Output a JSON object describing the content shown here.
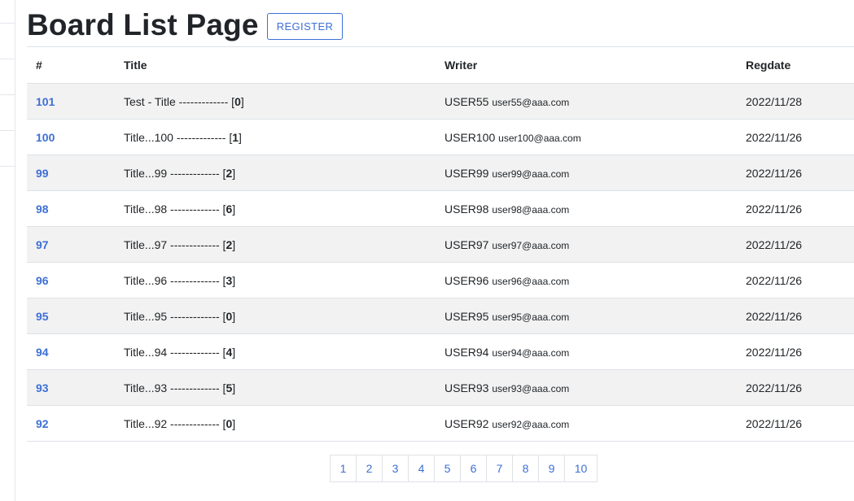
{
  "header": {
    "title": "Board List Page",
    "register_label": "REGISTER"
  },
  "table": {
    "columns": [
      "#",
      "Title",
      "Writer",
      "Regdate"
    ],
    "rows": [
      {
        "bno": "101",
        "title": "Test - Title ------------- [",
        "replies": "0",
        "writer": "USER55",
        "email": "user55@aaa.com",
        "regdate": "2022/11/28"
      },
      {
        "bno": "100",
        "title": "Title...100 ------------- [",
        "replies": "1",
        "writer": "USER100",
        "email": "user100@aaa.com",
        "regdate": "2022/11/26"
      },
      {
        "bno": "99",
        "title": "Title...99 ------------- [",
        "replies": "2",
        "writer": "USER99",
        "email": "user99@aaa.com",
        "regdate": "2022/11/26"
      },
      {
        "bno": "98",
        "title": "Title...98 ------------- [",
        "replies": "6",
        "writer": "USER98",
        "email": "user98@aaa.com",
        "regdate": "2022/11/26"
      },
      {
        "bno": "97",
        "title": "Title...97 ------------- [",
        "replies": "2",
        "writer": "USER97",
        "email": "user97@aaa.com",
        "regdate": "2022/11/26"
      },
      {
        "bno": "96",
        "title": "Title...96 ------------- [",
        "replies": "3",
        "writer": "USER96",
        "email": "user96@aaa.com",
        "regdate": "2022/11/26"
      },
      {
        "bno": "95",
        "title": "Title...95 ------------- [",
        "replies": "0",
        "writer": "USER95",
        "email": "user95@aaa.com",
        "regdate": "2022/11/26"
      },
      {
        "bno": "94",
        "title": "Title...94 ------------- [",
        "replies": "4",
        "writer": "USER94",
        "email": "user94@aaa.com",
        "regdate": "2022/11/26"
      },
      {
        "bno": "93",
        "title": "Title...93 ------------- [",
        "replies": "5",
        "writer": "USER93",
        "email": "user93@aaa.com",
        "regdate": "2022/11/26"
      },
      {
        "bno": "92",
        "title": "Title...92 ------------- [",
        "replies": "0",
        "writer": "USER92",
        "email": "user92@aaa.com",
        "regdate": "2022/11/26"
      }
    ]
  },
  "pagination": {
    "pages": [
      "1",
      "2",
      "3",
      "4",
      "5",
      "6",
      "7",
      "8",
      "9",
      "10"
    ]
  },
  "colors": {
    "accent": "#3d6fd6",
    "striped_row": "#f2f2f2",
    "border": "#dee2e6"
  }
}
